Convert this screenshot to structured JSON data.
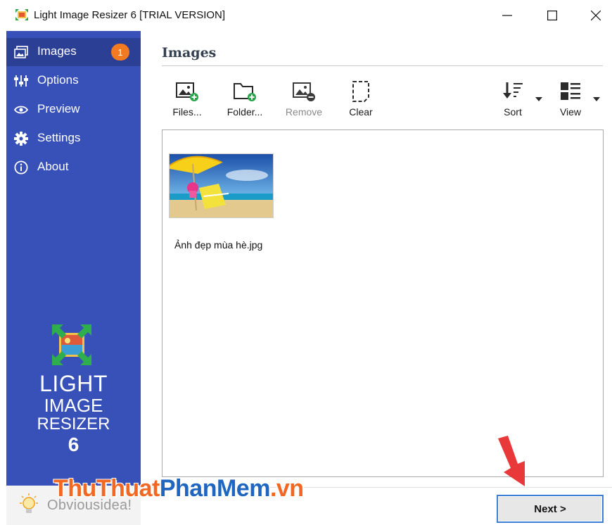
{
  "window": {
    "title": "Light Image Resizer 6  [TRIAL VERSION]",
    "controls": [
      "minimize-icon",
      "maximize-icon",
      "close-icon"
    ]
  },
  "sidebar": {
    "items": [
      {
        "label": "Images",
        "icon": "images-icon",
        "badge": "1",
        "active": true
      },
      {
        "label": "Options",
        "icon": "sliders-icon",
        "active": false
      },
      {
        "label": "Preview",
        "icon": "eye-icon",
        "active": false
      },
      {
        "label": "Settings",
        "icon": "gear-icon",
        "active": false
      },
      {
        "label": "About",
        "icon": "info-icon",
        "active": false
      }
    ],
    "brand": {
      "line1": "LIGHT",
      "line2": "IMAGE",
      "line3": "RESIZER",
      "line4": "6"
    },
    "footer_logo_text": "Obviousidea!"
  },
  "main": {
    "heading": "Images",
    "toolbar": {
      "files": "Files...",
      "folder": "Folder...",
      "remove": "Remove",
      "clear": "Clear",
      "sort": "Sort",
      "view": "View"
    },
    "files": [
      {
        "name": "Ảnh đẹp mùa hè.jpg",
        "thumb": "beach-umbrella-chair"
      }
    ],
    "next_button": "Next >"
  },
  "watermark": {
    "part1": "ThuThuat",
    "part2": "PhanMem",
    "part3": ".vn"
  },
  "colors": {
    "sidebar": "#3751b9",
    "sidebar_active": "#2b3f94",
    "badge": "#f37a21",
    "next_border": "#3d7fd8",
    "arrow": "#e8383a"
  }
}
